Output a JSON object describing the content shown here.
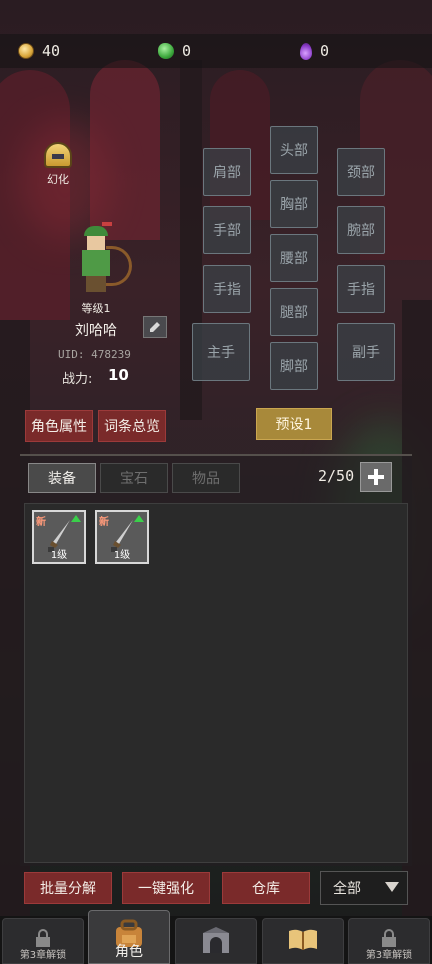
{
  "currency": {
    "gold": "40",
    "green_gem": "0",
    "purple_gem": "0"
  },
  "character": {
    "transform_label": "幻化",
    "level": "等级1",
    "name": "刘哈哈",
    "uid": "UID: 478239",
    "power_label": "战力:",
    "power_value": "10"
  },
  "slots": {
    "shoulder": "肩部",
    "head": "头部",
    "neck": "颈部",
    "hand": "手部",
    "chest": "胸部",
    "wrist": "腕部",
    "finger_left": "手指",
    "waist": "腰部",
    "finger_right": "手指",
    "main_hand": "主手",
    "leg": "腿部",
    "off_hand": "副手",
    "foot": "脚部"
  },
  "actions": {
    "attributes": "角色属性",
    "affixes": "词条总览",
    "preset": "预设1"
  },
  "inventory": {
    "tabs": [
      "装备",
      "宝石",
      "物品"
    ],
    "count": "2/50",
    "items": [
      {
        "badge": "新",
        "level": "1级"
      },
      {
        "badge": "新",
        "level": "1级"
      }
    ]
  },
  "bottom_actions": {
    "salvage": "批量分解",
    "enhance": "一键强化",
    "warehouse": "仓库",
    "filter": "全部"
  },
  "nav": {
    "items": [
      {
        "label": "第3章解锁",
        "icon": "lock-icon"
      },
      {
        "label": "角色",
        "icon": "backpack-icon"
      },
      {
        "label": "",
        "icon": "castle-gate-icon"
      },
      {
        "label": "",
        "icon": "book-icon"
      },
      {
        "label": "第3章解锁",
        "icon": "lock-icon"
      }
    ]
  },
  "colors": {
    "red_button": "#7a2a2a",
    "gold_button": "#a8893a",
    "slot_bg": "#3a4248",
    "new_badge": "#ff9a7a",
    "upgrade_arrow": "#3ad04a"
  }
}
